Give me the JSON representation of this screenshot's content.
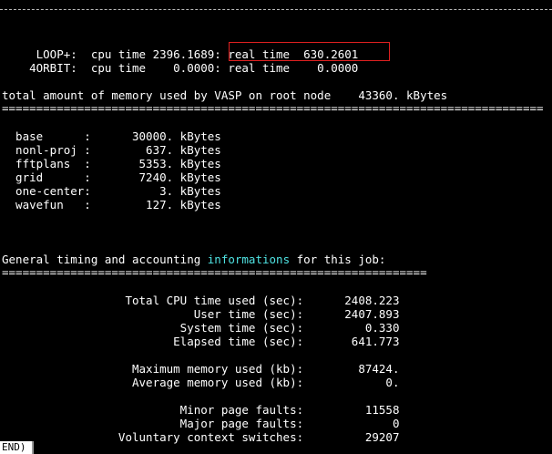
{
  "lines": {
    "loop_plus": "     LOOP+:  cpu time 2396.1689: real time  630.2601",
    "fourorbit": "    4ORBIT:  cpu time    0.0000: real time    0.0000",
    "total_memory": "total amount of memory used by VASP on root node    43360. kBytes",
    "separator1": "===============================================================================",
    "mem_base": "  base      :      30000. kBytes",
    "mem_nonl_proj": "  nonl-proj :        637. kBytes",
    "mem_fftplans": "  fftplans  :       5353. kBytes",
    "mem_grid": "  grid      :       7240. kBytes",
    "mem_one_center": "  one-center:          3. kBytes",
    "mem_wavefun": "  wavefun   :        127. kBytes",
    "general_prefix": "General timing and accounting ",
    "general_highlight": "informations",
    "general_suffix": " for this job:",
    "separator2": "==============================================================",
    "total_cpu": "                  Total CPU time used (sec):      2408.223",
    "user_time": "                            User time (sec):      2407.893",
    "system_time": "                          System time (sec):         0.330",
    "elapsed_time": "                         Elapsed time (sec):       641.773",
    "max_memory": "                   Maximum memory used (kb):        87424.",
    "avg_memory": "                   Average memory used (kb):            0.",
    "minor_faults": "                          Minor page faults:         11558",
    "major_faults": "                          Major page faults:             0",
    "voluntary_switches": "                 Voluntary context switches:         29207"
  },
  "prompt": "END)",
  "colors": {
    "background": "#000000",
    "text": "#ffffff",
    "highlight_word": "#4fe3e3",
    "box": "#e02020"
  }
}
